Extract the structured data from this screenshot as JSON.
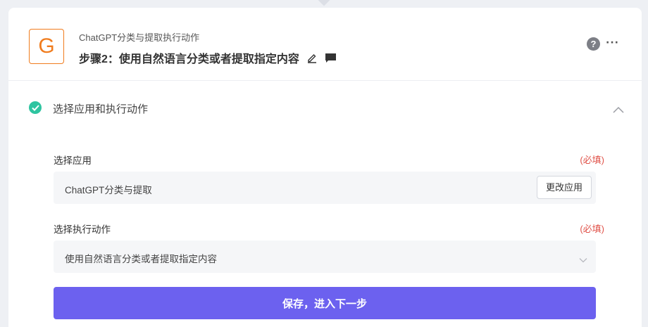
{
  "header": {
    "logo_letter": "G",
    "app_name": "ChatGPT分类与提取执行动作",
    "step_title": "步骤2：使用自然语言分类或者提取指定内容",
    "help_glyph": "?",
    "more_glyph": "···"
  },
  "section": {
    "title": "选择应用和执行动作"
  },
  "app_field": {
    "label": "选择应用",
    "required": "(必填)",
    "value": "ChatGPT分类与提取",
    "change_label": "更改应用"
  },
  "action_field": {
    "label": "选择执行动作",
    "required": "(必填)",
    "value": "使用自然语言分类或者提取指定内容"
  },
  "submit_label": "保存，进入下一步",
  "colors": {
    "accent": "#6c61ef",
    "logo": "#f07c1e",
    "success": "#2ec4a0",
    "required": "#e0534a"
  }
}
